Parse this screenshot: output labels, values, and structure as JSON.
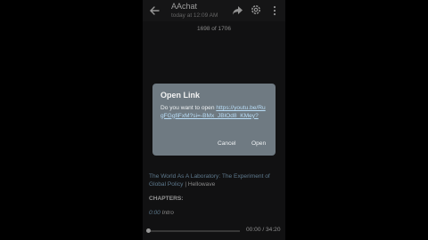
{
  "appbar": {
    "title": "AAchat",
    "subtitle": "today at 12:09 AM",
    "icons": [
      "back-arrow-icon",
      "share-icon",
      "gear-icon",
      "more-vertical-icon"
    ]
  },
  "page_counter": "1698 of 1706",
  "dialog": {
    "title": "Open Link",
    "prompt": "Do you want to open ",
    "link": "https://youtu.be/RugFGgfiFxM?si=-BMx_JBlOd8_KMey?",
    "cancel_label": "Cancel",
    "open_label": "Open"
  },
  "message": {
    "video_title": "The World As A Laboratory: The Experiment of Global Policy",
    "channel_suffix": " | Hellowave",
    "chapters_heading": "CHAPTERS:",
    "chapter_time": "0:00",
    "chapter_title": " Intro"
  },
  "player": {
    "time": "00:00 / 34:20",
    "progress": 0
  },
  "colors": {
    "dialog_bg": "#6f7a82",
    "link": "#8fb8d6"
  }
}
